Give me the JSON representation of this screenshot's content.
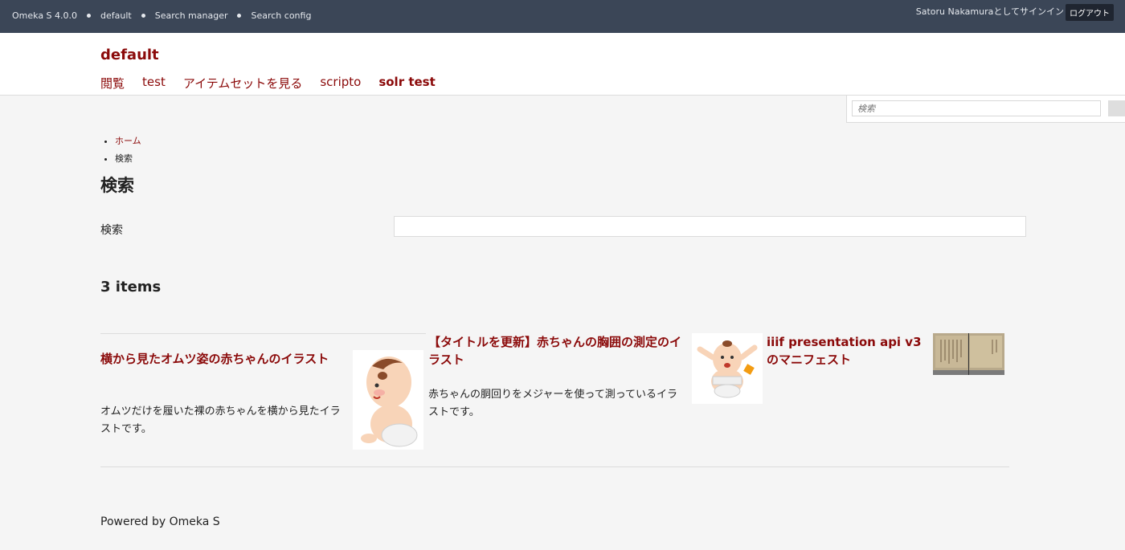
{
  "admin_bar": {
    "crumbs": [
      "Omeka S 4.0.0",
      "default",
      "Search manager",
      "Search config"
    ],
    "user_text": "Satoru Nakamuraとしてサインイン",
    "logout_label": "ログアウト"
  },
  "site": {
    "title": "default",
    "nav": [
      "閲覧",
      "test",
      "アイテムセットを見る",
      "scripto",
      "solr test"
    ]
  },
  "quick_search": {
    "placeholder": "検索"
  },
  "breadcrumbs": {
    "home": "ホーム",
    "current": "検索"
  },
  "page": {
    "title": "検索",
    "search_label": "検索",
    "count": "3 items"
  },
  "items": [
    {
      "title": "横から見たオムツ姿の赤ちゃんのイラスト",
      "description": "オムツだけを履いた裸の赤ちゃんを横から見たイラストです。"
    },
    {
      "title": "【タイトルを更新】赤ちゃんの胸囲の測定のイラスト",
      "description": "赤ちゃんの胴回りをメジャーを使って測っているイラストです。"
    },
    {
      "title": "iiif presentation api v3のマニフェスト",
      "description": ""
    }
  ],
  "footer": {
    "text": "Powered by Omeka S"
  },
  "colors": {
    "accent": "#8b0a0a",
    "admin_bar": "#3b4657"
  }
}
